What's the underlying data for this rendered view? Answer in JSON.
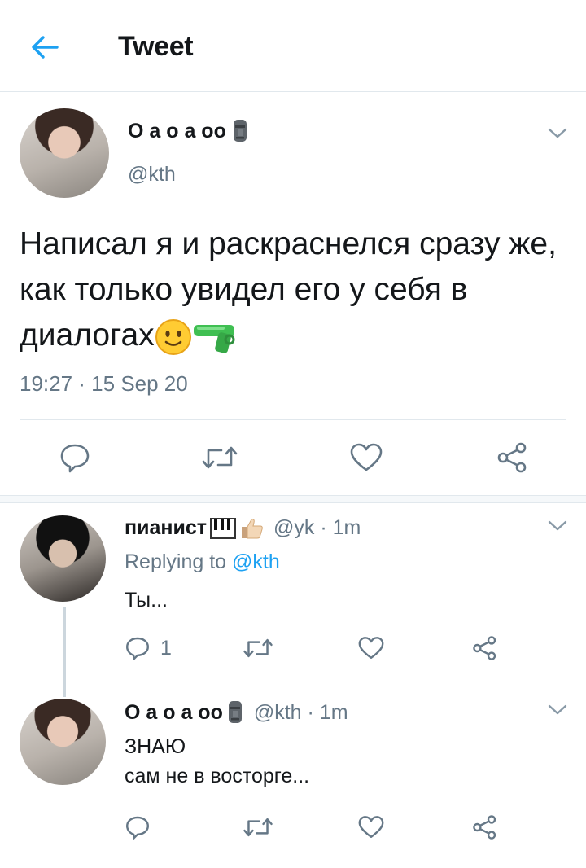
{
  "header": {
    "title": "Tweet",
    "back_icon": "arrow-left-icon",
    "accent": "#1da1f2"
  },
  "tweet": {
    "name": "О а о а оо",
    "name_emoji": "moai-icon",
    "handle": "@kth",
    "text": "Написал я и раскраснелся сразу же, как только увидел его у себя в диалогах",
    "text_emojis": [
      "slightly-smiling-face-icon",
      "water-pistol-icon"
    ],
    "time": "19:27 · 15 Sep 20",
    "actions": [
      "reply-icon",
      "retweet-icon",
      "like-icon",
      "share-icon"
    ]
  },
  "replies": [
    {
      "name": "пианист",
      "name_emojis": [
        "piano-keys-icon",
        "thumbs-up-icon"
      ],
      "meta": "@yk · 1m",
      "replying_prefix": "Replying to ",
      "replying_to": "@kth",
      "text": "Ты...",
      "reply_count": "1"
    },
    {
      "name": "О а о а оо",
      "name_emojis": [
        "moai-icon"
      ],
      "meta": "@kth · 1m",
      "text_line1": "ЗНАЮ",
      "text_line2": "сам не в восторге..."
    }
  ],
  "colors": {
    "text": "#14171a",
    "secondary": "#657786",
    "link": "#1da1f2",
    "divider": "#e1e8ed"
  }
}
